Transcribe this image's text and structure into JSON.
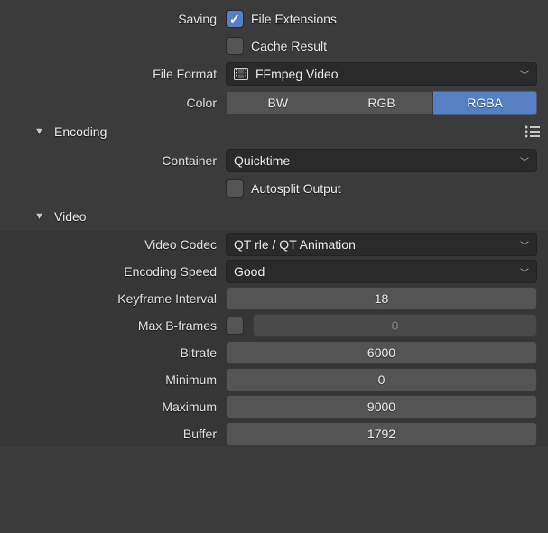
{
  "saving": {
    "label": "Saving",
    "file_extensions_label": "File Extensions",
    "file_extensions_checked": true,
    "cache_result_label": "Cache Result",
    "cache_result_checked": false
  },
  "file_format": {
    "label": "File Format",
    "value": "FFmpeg Video"
  },
  "color": {
    "label": "Color",
    "options": [
      "BW",
      "RGB",
      "RGBA"
    ],
    "active": "RGBA"
  },
  "encoding": {
    "title": "Encoding",
    "container_label": "Container",
    "container_value": "Quicktime",
    "autosplit_label": "Autosplit Output",
    "autosplit_checked": false
  },
  "video": {
    "title": "Video",
    "codec_label": "Video Codec",
    "codec_value": "QT rle / QT Animation",
    "speed_label": "Encoding Speed",
    "speed_value": "Good",
    "keyframe_label": "Keyframe Interval",
    "keyframe_value": "18",
    "max_bframes_label": "Max B-frames",
    "max_bframes_checked": false,
    "max_bframes_value": "0",
    "bitrate_label": "Bitrate",
    "bitrate_value": "6000",
    "minimum_label": "Minimum",
    "minimum_value": "0",
    "maximum_label": "Maximum",
    "maximum_value": "9000",
    "buffer_label": "Buffer",
    "buffer_value": "1792"
  }
}
